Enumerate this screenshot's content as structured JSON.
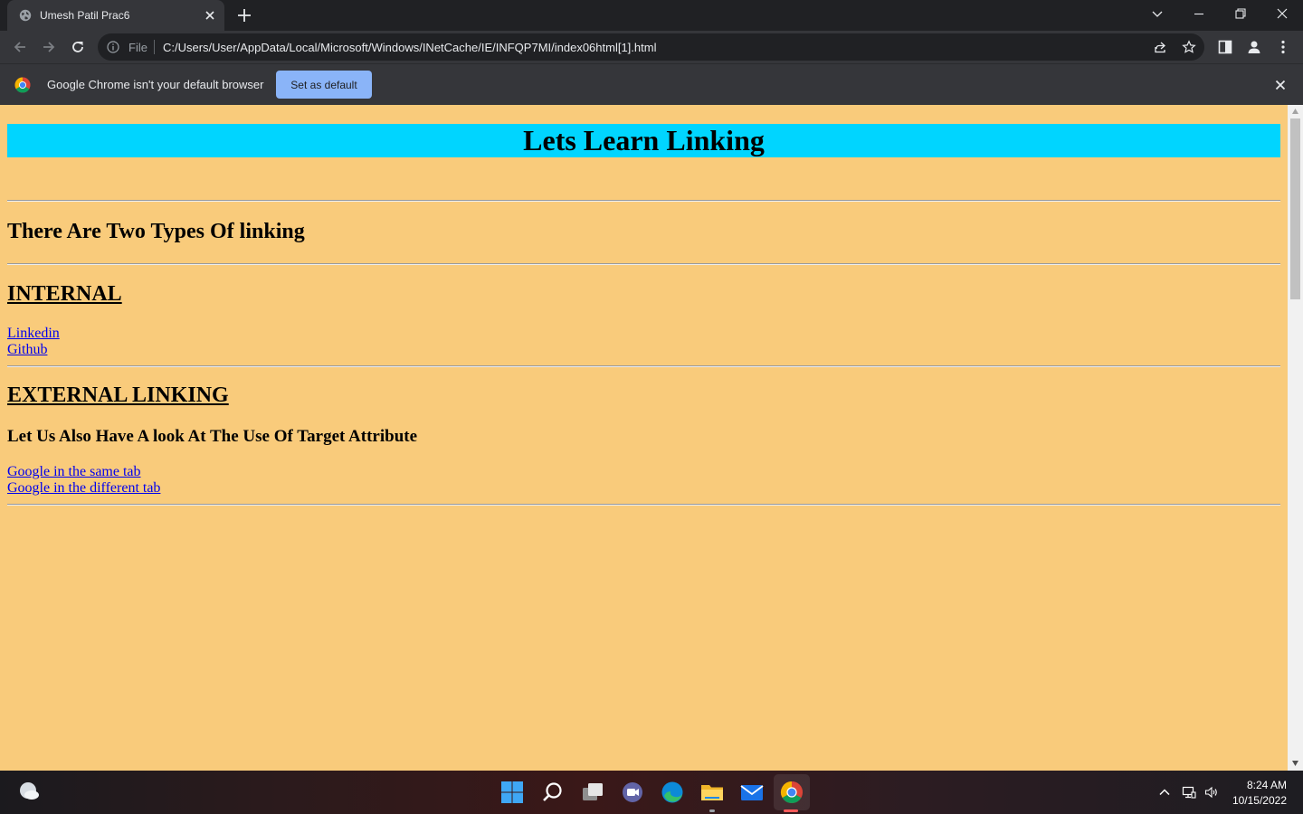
{
  "browser": {
    "tab_title": "Umesh Patil Prac6",
    "url_scheme": "File",
    "url": "C:/Users/User/AppData/Local/Microsoft/Windows/INetCache/IE/INFQP7MI/index06html[1].html"
  },
  "infobar": {
    "message": "Google Chrome isn't your default browser",
    "button_label": "Set as default"
  },
  "page": {
    "banner_title": "Lets Learn Linking",
    "types_heading": "There Are Two Types Of linking",
    "internal_heading": "INTERNAL",
    "internal_links": [
      "Linkedin",
      "Github"
    ],
    "external_heading": "EXTERNAL LINKING",
    "target_heading": "Let Us Also Have A look At The Use Of Target Attribute",
    "external_links": [
      "Google in the same tab",
      "Google in the different tab"
    ],
    "colors": {
      "background": "#f9cb7b",
      "banner": "#00d5ff",
      "link": "#0000ee"
    }
  },
  "taskbar": {
    "apps": [
      "start-icon",
      "search-icon",
      "task-view-icon",
      "chat-icon",
      "edge-icon",
      "file-explorer-icon",
      "mail-icon",
      "chrome-icon"
    ],
    "time": "8:24 AM",
    "date": "10/15/2022"
  }
}
